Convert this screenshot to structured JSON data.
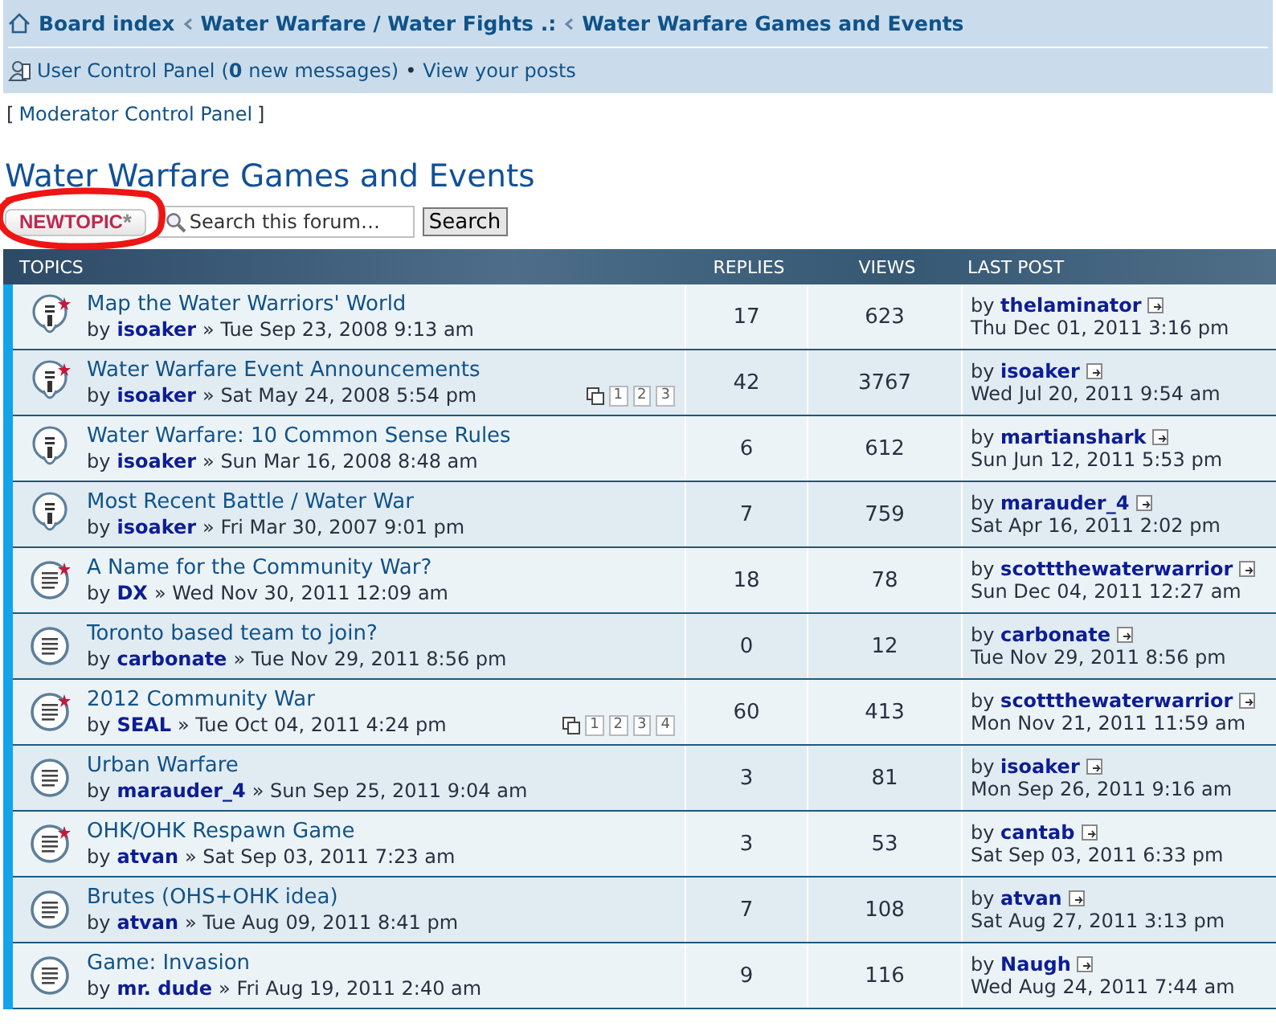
{
  "breadcrumbs": [
    "Board index",
    "Water Warfare / Water Fights .:",
    "Water Warfare Games and Events"
  ],
  "user_bar": {
    "ucp": "User Control Panel",
    "ucp_open": "(",
    "new_count": "0",
    "new_label": "new messages)",
    "bullet": "•",
    "posts": "View your posts"
  },
  "moderator": {
    "open": "[",
    "link": "Moderator Control Panel",
    "close": "]"
  },
  "forum_title": "Water Warfare Games and Events",
  "new_topic_button": {
    "label": "NEWTOPIC",
    "star": "*",
    "circled": true
  },
  "search": {
    "placeholder": "Search this forum…",
    "button": "Search"
  },
  "table": {
    "columns": [
      "TOPICS",
      "REPLIES",
      "VIEWS",
      "LAST POST"
    ],
    "rows": [
      {
        "kind": "sticky",
        "new": true,
        "title": "Map the Water Warriors' World",
        "byline": "by **isoaker** » Tue Sep 23, 2008 9:13 am",
        "replies": "17",
        "views": "623",
        "last_by": "by **thelaminator**",
        "last_date": "Thu Dec 01, 2011 3:16 pm"
      },
      {
        "kind": "sticky",
        "new": true,
        "title": "Water Warfare Event Announcements",
        "byline": "by **isoaker** » Sat May 24, 2008 5:54 pm",
        "pages": [
          "1",
          "2",
          "3"
        ],
        "replies": "42",
        "views": "3767",
        "last_by": "by **isoaker**",
        "last_date": "Wed Jul 20, 2011 9:54 am"
      },
      {
        "kind": "sticky",
        "new": false,
        "title": "Water Warfare: 10 Common Sense Rules",
        "byline": "by **isoaker** » Sun Mar 16, 2008 8:48 am",
        "replies": "6",
        "views": "612",
        "last_by": "by **martianshark**",
        "last_date": "Sun Jun 12, 2011 5:53 pm"
      },
      {
        "kind": "sticky",
        "new": false,
        "title": "Most Recent Battle / Water War",
        "byline": "by **isoaker** » Fri Mar 30, 2007 9:01 pm",
        "replies": "7",
        "views": "759",
        "last_by": "by **marauder_4**",
        "last_date": "Sat Apr 16, 2011 2:02 pm"
      },
      {
        "kind": "topic",
        "new": true,
        "title": "A Name for the Community War?",
        "byline": "by **DX** » Wed Nov 30, 2011 12:09 am",
        "replies": "18",
        "views": "78",
        "last_by": "by **scottthewaterwarrior**",
        "last_date": "Sun Dec 04, 2011 12:27 am"
      },
      {
        "kind": "topic",
        "new": false,
        "title": "Toronto based team to join?",
        "byline": "by **carbonate** » Tue Nov 29, 2011 8:56 pm",
        "replies": "0",
        "views": "12",
        "last_by": "by **carbonate**",
        "last_date": "Tue Nov 29, 2011 8:56 pm"
      },
      {
        "kind": "topic",
        "new": true,
        "title": "2012 Community War",
        "byline": "by **SEAL** » Tue Oct 04, 2011 4:24 pm",
        "pages": [
          "1",
          "2",
          "3",
          "4"
        ],
        "replies": "60",
        "views": "413",
        "last_by": "by **scottthewaterwarrior**",
        "last_date": "Mon Nov 21, 2011 11:59 am"
      },
      {
        "kind": "topic",
        "new": false,
        "title": "Urban Warfare",
        "byline": "by **marauder_4** » Sun Sep 25, 2011 9:04 am",
        "replies": "3",
        "views": "81",
        "last_by": "by **isoaker**",
        "last_date": "Mon Sep 26, 2011 9:16 am"
      },
      {
        "kind": "topic",
        "new": true,
        "title": "OHK/OHK Respawn Game",
        "byline": "by **atvan** » Sat Sep 03, 2011 7:23 am",
        "replies": "3",
        "views": "53",
        "last_by": "by **cantab**",
        "last_date": "Sat Sep 03, 2011 6:33 pm"
      },
      {
        "kind": "topic",
        "new": false,
        "title": "Brutes (OHS+OHK idea)",
        "byline": "by **atvan** » Tue Aug 09, 2011 8:41 pm",
        "replies": "7",
        "views": "108",
        "last_by": "by **atvan**",
        "last_date": "Sat Aug 27, 2011 3:13 pm"
      },
      {
        "kind": "topic",
        "new": false,
        "title": "Game: Invasion",
        "byline": "by **mr. dude** » Fri Aug 19, 2011 2:40 am",
        "replies": "9",
        "views": "116",
        "last_by": "by **Naugh**",
        "last_date": "Wed Aug 24, 2011 7:44 am"
      }
    ]
  }
}
